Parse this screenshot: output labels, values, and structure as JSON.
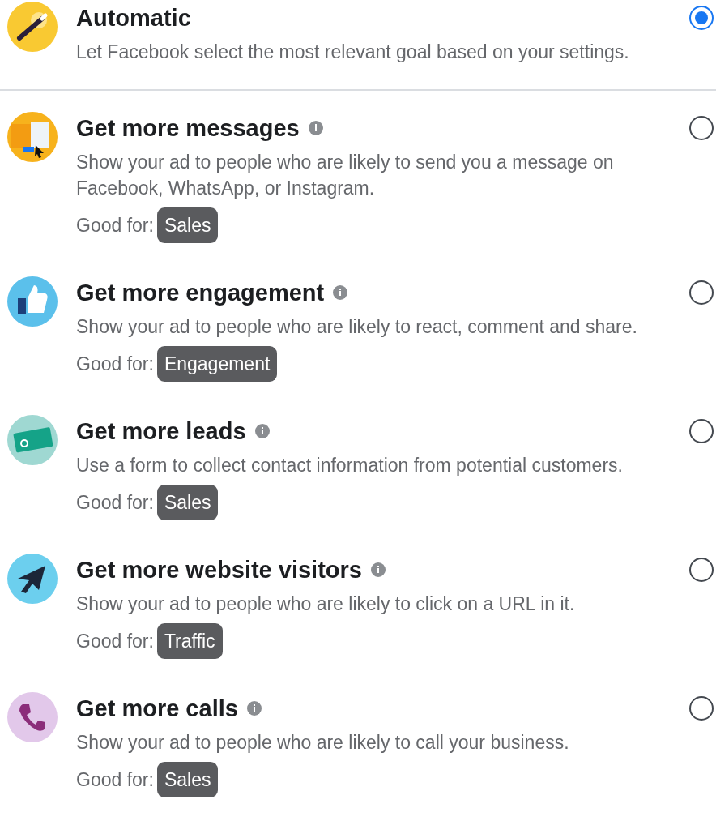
{
  "automatic": {
    "title": "Automatic",
    "description": "Let Facebook select the most relevant goal based on your settings.",
    "selected": true
  },
  "options": [
    {
      "title": "Get more messages",
      "info": true,
      "description": "Show your ad to people who are likely to send you a message on Facebook, WhatsApp, or Instagram.",
      "good_for_label": "Good for:",
      "tag": "Sales",
      "selected": false
    },
    {
      "title": "Get more engagement",
      "info": true,
      "description": "Show your ad to people who are likely to react, comment and share.",
      "good_for_label": "Good for:",
      "tag": "Engagement",
      "selected": false
    },
    {
      "title": "Get more leads",
      "info": true,
      "description": "Use a form to collect contact information from potential customers.",
      "good_for_label": "Good for:",
      "tag": "Sales",
      "selected": false
    },
    {
      "title": "Get more website visitors",
      "info": true,
      "description": "Show your ad to people who are likely to click on a URL in it.",
      "good_for_label": "Good for:",
      "tag": "Traffic",
      "selected": false
    },
    {
      "title": "Get more calls",
      "info": true,
      "description": "Show your ad to people who are likely to call your business.",
      "good_for_label": "Good for:",
      "tag": "Sales",
      "selected": false
    }
  ]
}
